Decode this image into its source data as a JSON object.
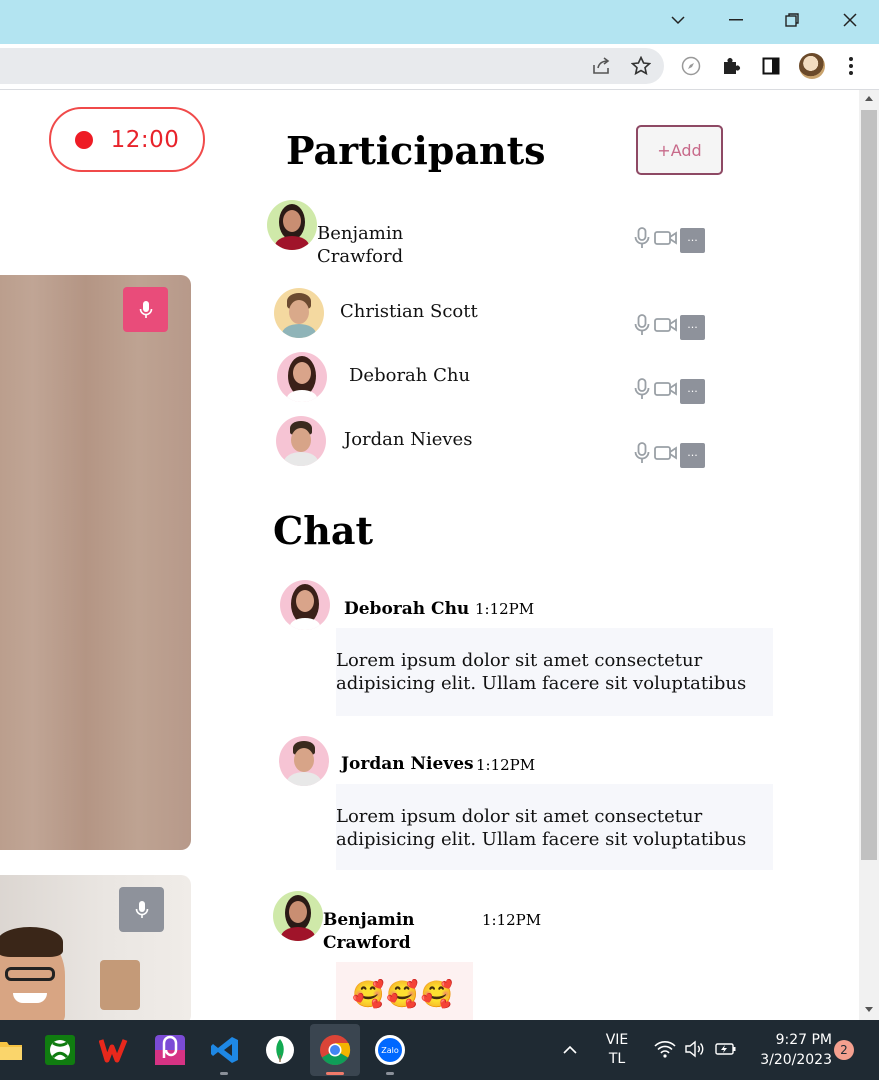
{
  "browser": {
    "window_controls": [
      "minimize",
      "restore",
      "close"
    ],
    "extensions": [
      "share-icon",
      "star-icon",
      "compass-icon",
      "puzzle-icon",
      "sidepanel-icon",
      "profile-avatar",
      "menu-icon"
    ]
  },
  "recording": {
    "time": "12:00"
  },
  "participants": {
    "title": "Participants",
    "add_label": "+Add",
    "more_label": "···",
    "list": [
      {
        "name": "Benjamin Crawford"
      },
      {
        "name": "Christian Scott"
      },
      {
        "name": "Deborah Chu"
      },
      {
        "name": "Jordan Nieves"
      }
    ]
  },
  "chat": {
    "title": "Chat",
    "messages": [
      {
        "author": "Deborah Chu",
        "time": "1:12PM",
        "text": "Lorem ipsum dolor sit amet consectetur adipisicing elit. Ullam facere sit voluptatibus"
      },
      {
        "author": "Jordan Nieves",
        "time": "1:12PM",
        "text": "Lorem ipsum dolor sit amet consectetur adipisicing elit. Ullam facere sit voluptatibus"
      },
      {
        "author": "Benjamin Crawford",
        "time": "1:12PM",
        "text": "🥰🥰🥰"
      }
    ]
  },
  "taskbar": {
    "apps": [
      "file-explorer-icon",
      "xbox-icon",
      "wps-office-icon",
      "photo-app-icon",
      "vscode-icon",
      "mongodb-icon",
      "chrome-icon",
      "zalo-icon"
    ],
    "zalo_label": "Zalo",
    "lang_line1": "VIE",
    "lang_line2": "TL",
    "clock_time": "9:27 PM",
    "clock_date": "3/20/2023",
    "notification_count": "2"
  },
  "colors": {
    "accent_red": "#ee1c25",
    "add_border": "#8e4964",
    "mic_active": "#e94c7a",
    "mic_idle": "#8e929b",
    "titlebar": "#b3e4f1",
    "taskbar": "#1f2a33"
  }
}
